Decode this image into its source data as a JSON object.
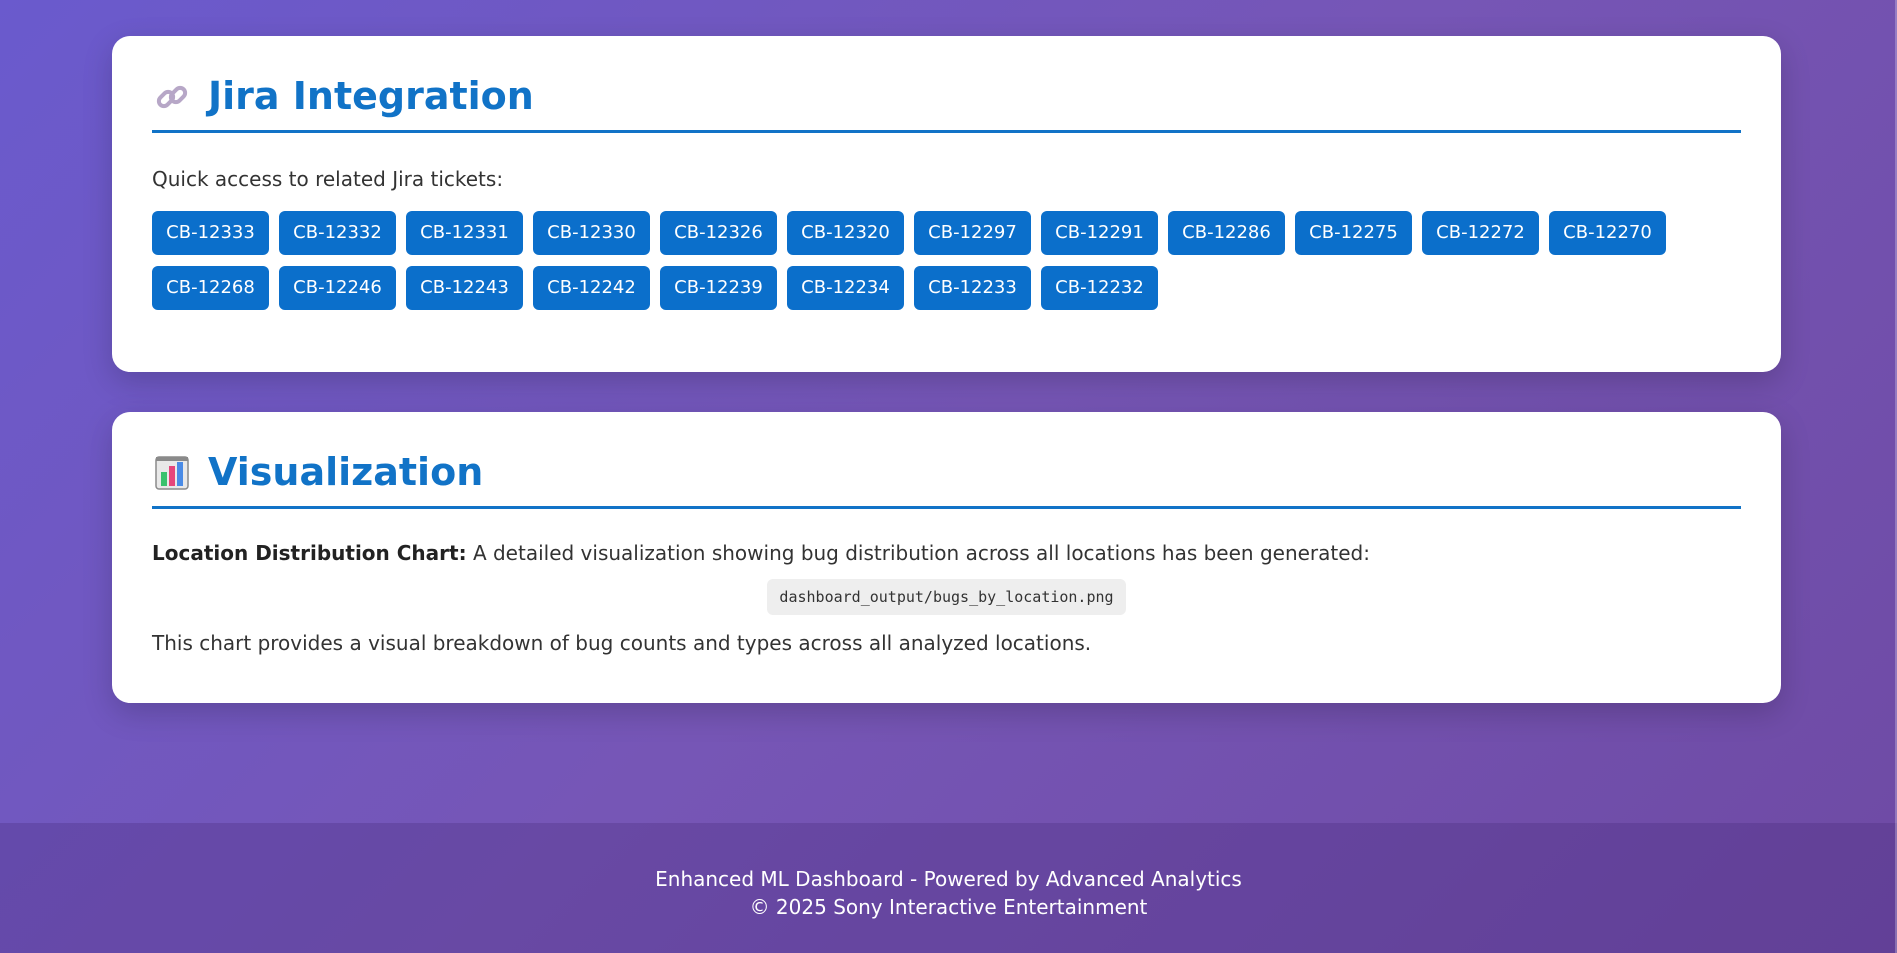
{
  "jira": {
    "title": "Jira Integration",
    "icon": "link-icon",
    "intro": "Quick access to related Jira tickets:",
    "tickets": [
      "CB-12333",
      "CB-12332",
      "CB-12331",
      "CB-12330",
      "CB-12326",
      "CB-12320",
      "CB-12297",
      "CB-12291",
      "CB-12286",
      "CB-12275",
      "CB-12272",
      "CB-12270",
      "CB-12268",
      "CB-12246",
      "CB-12243",
      "CB-12242",
      "CB-12239",
      "CB-12234",
      "CB-12233",
      "CB-12232"
    ]
  },
  "visualization": {
    "title": "Visualization",
    "icon": "bar-chart-icon",
    "label": "Location Distribution Chart:",
    "description": " A detailed visualization showing bug distribution across all locations has been generated:",
    "path": "dashboard_output/bugs_by_location.png",
    "note": "This chart provides a visual breakdown of bug counts and types across all analyzed locations."
  },
  "footer": {
    "line1": "Enhanced ML Dashboard - Powered by Advanced Analytics",
    "line2": "© 2025 Sony Interactive Entertainment"
  },
  "colors": {
    "accent": "#1173c7",
    "button": "#0b6fcb",
    "background_start": "#6a5acd",
    "background_end": "#6e4aa4"
  }
}
